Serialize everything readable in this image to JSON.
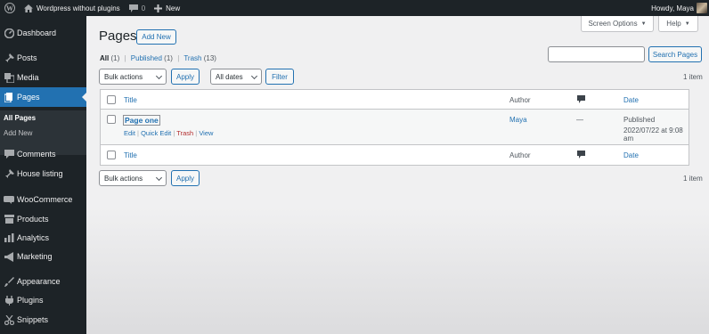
{
  "admin_bar": {
    "site_name": "Wordpress without plugins",
    "comments_count": "0",
    "new_label": "New",
    "greeting": "Howdy, Maya"
  },
  "sidebar": {
    "items": [
      {
        "label": "Dashboard",
        "icon": "dashboard-icon"
      },
      {
        "label": "Posts",
        "icon": "pin-icon"
      },
      {
        "label": "Media",
        "icon": "media-icon"
      },
      {
        "label": "Pages",
        "icon": "pages-icon",
        "active": true
      },
      {
        "label": "Comments",
        "icon": "comment-icon"
      },
      {
        "label": "House listing",
        "icon": "pin-icon"
      },
      {
        "label": "WooCommerce",
        "icon": "woocommerce-icon"
      },
      {
        "label": "Products",
        "icon": "archive-icon"
      },
      {
        "label": "Analytics",
        "icon": "bar-chart-icon"
      },
      {
        "label": "Marketing",
        "icon": "megaphone-icon"
      },
      {
        "label": "Appearance",
        "icon": "brush-icon"
      },
      {
        "label": "Plugins",
        "icon": "plug-icon"
      },
      {
        "label": "Snippets",
        "icon": "scissors-icon"
      }
    ],
    "submenu": {
      "all_pages": "All Pages",
      "add_new": "Add New"
    }
  },
  "header": {
    "screen_options": "Screen Options",
    "help": "Help",
    "title": "Pages",
    "add_new": "Add New"
  },
  "views": {
    "all": "All",
    "all_count": "(1)",
    "published": "Published",
    "published_count": "(1)",
    "trash": "Trash",
    "trash_count": "(13)",
    "separator": "|"
  },
  "filters": {
    "bulk_actions": "Bulk actions",
    "apply": "Apply",
    "all_dates": "All dates",
    "filter": "Filter",
    "search_button": "Search Pages",
    "search_value": ""
  },
  "items_count": "1 item",
  "table": {
    "columns": {
      "title": "Title",
      "author": "Author",
      "date": "Date"
    },
    "rows": [
      {
        "title": "Page one",
        "author": "Maya",
        "comments": "—",
        "status": "Published",
        "date": "2022/07/22 at 9:08 am",
        "actions": {
          "edit": "Edit",
          "quick_edit": "Quick Edit",
          "trash": "Trash",
          "view": "View"
        }
      }
    ]
  },
  "bottom": {
    "bulk_actions": "Bulk actions",
    "apply": "Apply",
    "items_count": "1 item"
  },
  "colors": {
    "sidebar_bg": "#1d2327",
    "accent": "#2271b1",
    "trash": "#b32d2e"
  }
}
